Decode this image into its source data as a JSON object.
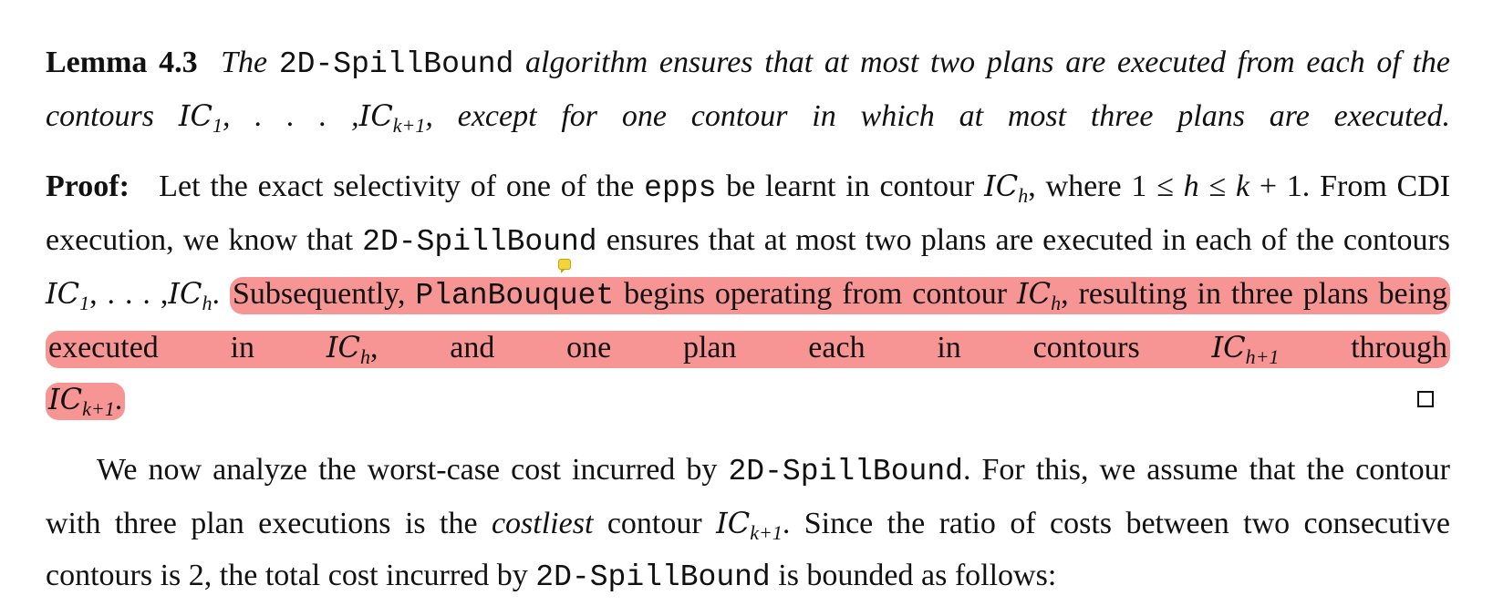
{
  "lemma": {
    "label": "Lemma 4.3",
    "w_the": "The",
    "algo_name": "2D-SpillBound",
    "line1_rest": "algorithm ensures that at most two plans are executed from each",
    "line2_a": "of the contours",
    "ic": "IC",
    "sub_1": "1",
    "ellipsis": ", . . . ,",
    "sub_k1": "k+1",
    "line2_b": ", except for one contour in which at most three plans are executed."
  },
  "proof": {
    "label": "Proof:",
    "l1_a": "Let the exact selectivity of one of the",
    "epps": "epps",
    "l1_b": "be learnt in contour",
    "ic": "IC",
    "sub_h": "h",
    "l1_c": ", where",
    "one": "1",
    "leq": "≤",
    "h": "h",
    "k": "k",
    "plus1": "+ 1.",
    "l2_a": "From CDI execution, we know that",
    "algo_name": "2D-SpillBound",
    "l2_b": "ensures that at most two plans are executed",
    "l3_a": "in each of the contours",
    "sub_1": "1",
    "ellipsis": ", . . . ,",
    "dot": ".",
    "subsequently": "Subsequently,",
    "planbouquet": "PlanBouquet",
    "l3_b": "begins operating from contour",
    "l4_a": ", resulting in three plans being executed in",
    "l4_b": ", and one plan each in contours",
    "sub_h1": "h+1",
    "through": "through",
    "sub_k1": "k+1",
    "end_dot": "."
  },
  "para2": {
    "s1_a": "We now analyze the worst-case cost incurred by",
    "algo_name": "2D-SpillBound",
    "s1_b": ". For this, we assume that the contour with three plan executions is the",
    "costliest": "costliest",
    "s1_c": "contour",
    "ic": "IC",
    "sub_k1": "k+1",
    "s2_a": ".  Since the ratio of costs between two consecutive contours is",
    "two": "2",
    "s2_b": ", the total cost incurred by",
    "s2_c": "is bounded as follows:"
  },
  "colors": {
    "highlight": "#f79494",
    "note": "#f2d43c"
  }
}
